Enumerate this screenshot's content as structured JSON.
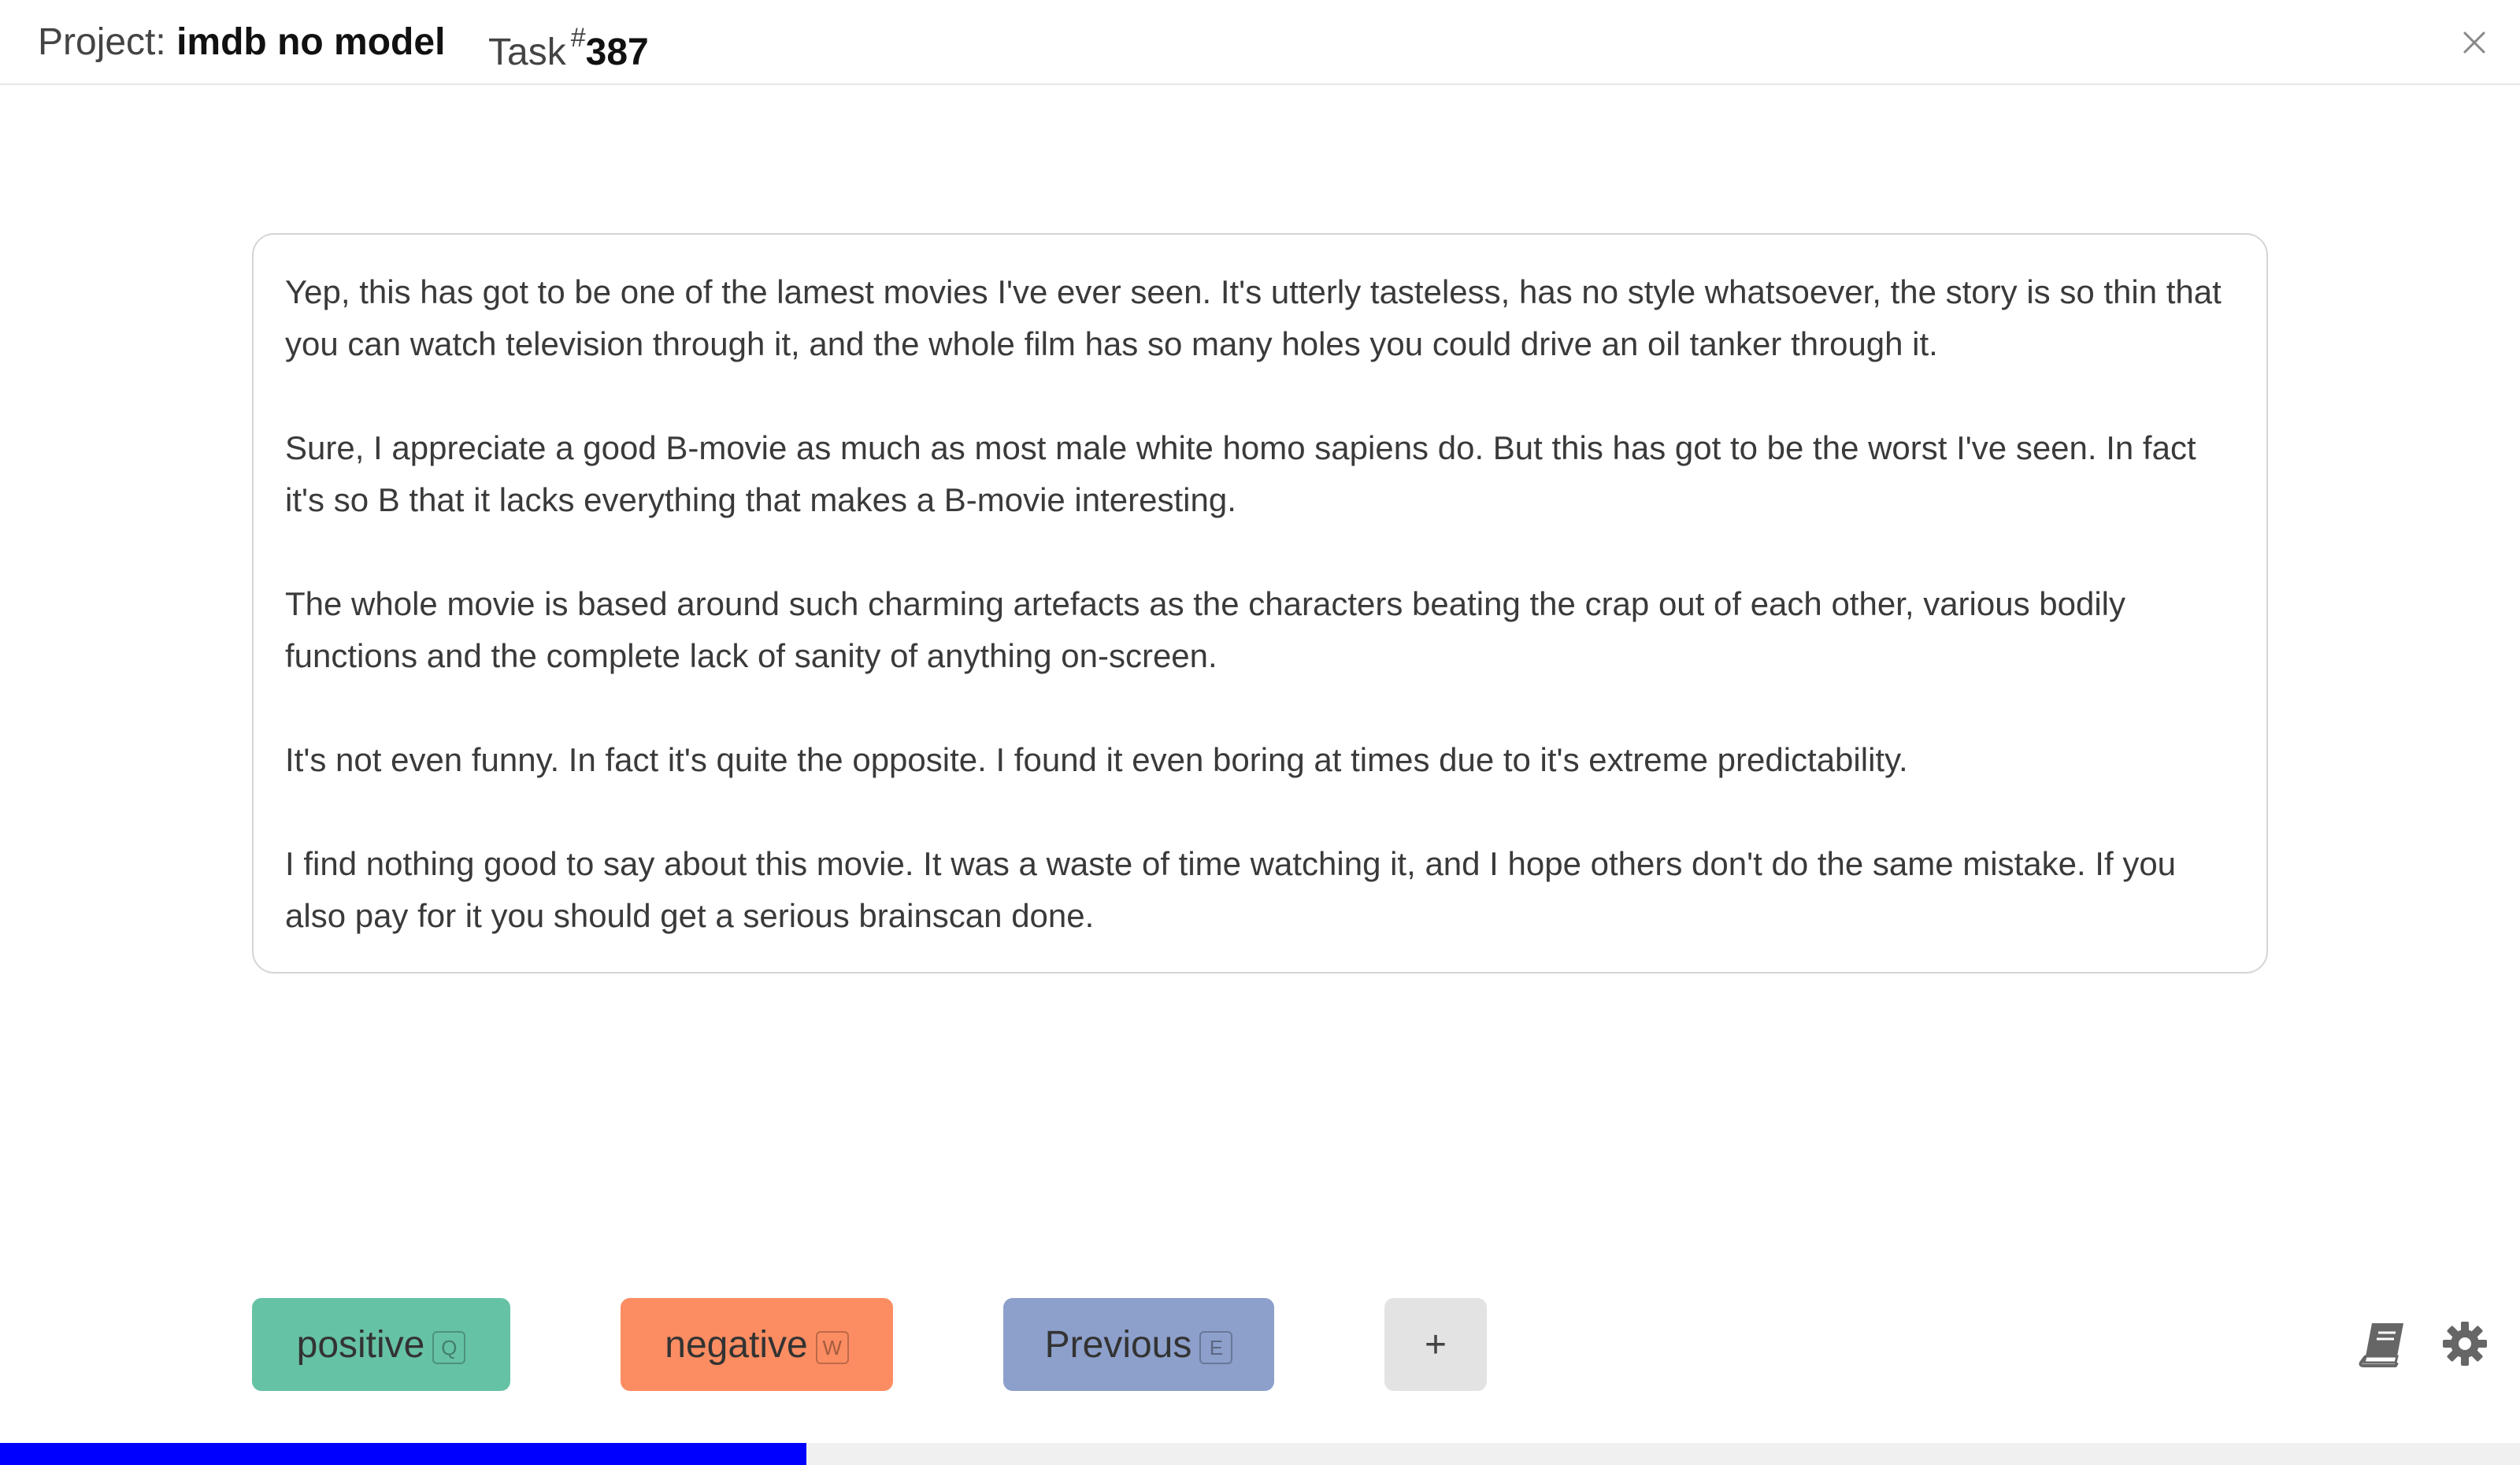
{
  "header": {
    "project_prefix": "Project:",
    "project_name": "imdb no model",
    "task_prefix": "Task",
    "task_hash": "#",
    "task_number": "387"
  },
  "review": {
    "paragraphs": [
      "Yep, this has got to be one of the lamest movies I've ever seen. It's utterly tasteless, has no style whatsoever, the story is so thin that you can watch television through it, and the whole film has so many holes you could drive an oil tanker through it.",
      "Sure, I appreciate a good B-movie as much as most male white homo sapiens do. But this has got to be the worst I've seen. In fact it's so B that it lacks everything that makes a B-movie interesting.",
      "The whole movie is based around such charming artefacts as the characters beating the crap out of each other, various bodily functions and the complete lack of sanity of anything on-screen.",
      "It's not even funny. In fact it's quite the opposite. I found it even boring at times due to it's extreme predictability.",
      "I find nothing good to say about this movie. It was a waste of time watching it, and I hope others don't do the same mistake. If you also pay for it you should get a serious brainscan done."
    ]
  },
  "buttons": {
    "positive": {
      "label": "positive",
      "key": "Q",
      "color": "#66c2a5"
    },
    "negative": {
      "label": "negative",
      "key": "W",
      "color": "#fc8d62"
    },
    "previous": {
      "label": "Previous",
      "key": "E",
      "color": "#8da0cb"
    },
    "add": {
      "label": "+"
    }
  },
  "icons": {
    "close": "close-icon",
    "book": "book-icon",
    "settings": "gear-icon"
  },
  "progress": {
    "fraction": 0.32,
    "color": "#0000ff"
  }
}
